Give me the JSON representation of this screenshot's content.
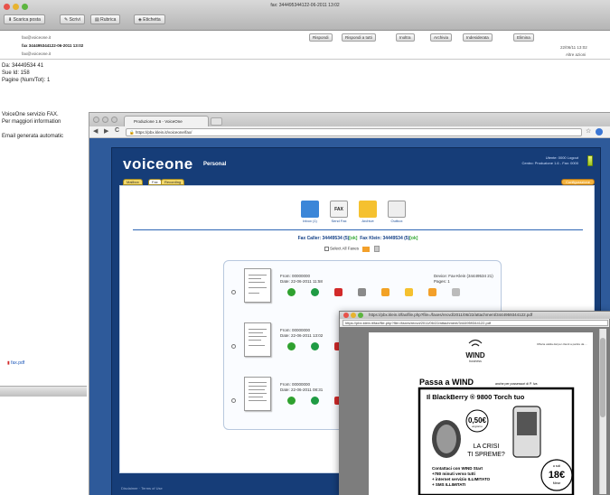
{
  "mail": {
    "window_title": "fax: 344495344122-06-2011 13:02",
    "toolbar": [
      "Scarica posta",
      "Scrivi",
      "Rubrica",
      "Etichetta"
    ],
    "header_buttons": [
      "Rispondi",
      "Rispondi a tutti",
      "Inoltra",
      "Archivia",
      "Indesiderata",
      "Elimina"
    ],
    "from": "fax@voiceone.it",
    "subject": "fax 344495344122-06-2011 13:02",
    "to": "fax@voiceone.it",
    "date": "22/06/11 13:02",
    "other_actions": "Altre azioni",
    "body_lines": [
      "Da: 34449534 41",
      "Sue Id: 158",
      "Pagine (Num/Tot): 1",
      "",
      "",
      "VoiceOne servizio FAX.",
      "Per maggiori information",
      "",
      "Email generata automatic"
    ],
    "attachment": "fax.pdf"
  },
  "browser": {
    "tab_title": "Produzione 1.6 - VoiceOne",
    "address": "https://pbx.klein.it/voiceone/fax/",
    "nav": {
      "back": "◀",
      "forward": "▶",
      "reload": "C",
      "star": "☆"
    }
  },
  "voiceone": {
    "logo": "voiceone",
    "sub": "Personal",
    "user_line1": "Utente: 0000 Logout",
    "user_line2": "Centro: Produzione 1.6 - Fax: 0000",
    "tabs": [
      "Mailbox",
      "Fax",
      "Recording"
    ],
    "config": "Configurazione",
    "apps": [
      {
        "label": "Inbox (1)",
        "color": "#3b86d8",
        "icon": "inbox-icon"
      },
      {
        "label": "Send Fax",
        "color": "#f2f2f2",
        "icon": "send-fax-icon",
        "text": "FAX"
      },
      {
        "label": "Archive",
        "color": "#f5c12f",
        "icon": "archive-icon"
      },
      {
        "label": "Outbox",
        "color": "#eeeeee",
        "icon": "outbox-icon"
      }
    ],
    "status_caller": "Fax Caller: 34449534 (5)",
    "status_caller_state": "[ok]",
    "status_klein": "Fax Klein: 34449534 (5)",
    "status_klein_state": "[ok]",
    "select_all": "Select All Faxes",
    "faxes": [
      {
        "from": "From: 00000000",
        "date": "Date: 22-06-2011 11:58",
        "device": "Device: Fax-Klein (34449534 21)",
        "pages": "Pages: 1"
      },
      {
        "from": "From: 00000000",
        "date": "Date: 22-06-2011 13:02",
        "device": "",
        "pages": ""
      },
      {
        "from": "From: 00000000",
        "date": "Date: 22-06-2011 08:31",
        "device": "",
        "pages": ""
      }
    ],
    "actions": [
      {
        "icon": "play-icon",
        "color": "#2fa12f"
      },
      {
        "icon": "refresh-icon",
        "color": "#1f9b44"
      },
      {
        "icon": "pdf-icon",
        "color": "#d22a2a"
      },
      {
        "icon": "print-icon",
        "color": "#8a8a8a"
      },
      {
        "icon": "forward-icon",
        "color": "#f2a225"
      },
      {
        "icon": "edit-icon",
        "color": "#f5c12f"
      },
      {
        "icon": "folder-icon",
        "color": "#f3a02a"
      },
      {
        "icon": "delete-icon",
        "color": "#bbbbbb"
      }
    ],
    "footer": "Disclaimer · Terms of Use"
  },
  "popup": {
    "title": "https://pbx.klein.it/fax/file.php?file=/faxes/recvd/2011/06/22/attachment/3444959344122.pdf",
    "address": "https://pbx.klein.it/fax/file.php?file=/faxes/recvd/2011/06/22/attachment/3444959344122.pdf",
    "ad": {
      "brand": "WIND",
      "brand_sub": "business",
      "corner": "Offerta valida dal per clienti a partire da ...",
      "headline": "Passa a WIND",
      "headline_rest": "anche per possessori di P. Iva",
      "phone_title": "Il BlackBerry ® 9800 Torch tuo",
      "price1": "0,50€",
      "price1_sub": "al giorno",
      "question1": "LA CRISI",
      "question2": "TI SPREME?",
      "bullets": [
        "Contattaci con WIND Start",
        "+780 minuti verso tutti",
        "+ internet servizio ILLIMITATO",
        "+ SMS ILLIMITATI"
      ],
      "price2": "18€",
      "price2_pre": "a soli",
      "price2_sub": "Mese"
    }
  }
}
